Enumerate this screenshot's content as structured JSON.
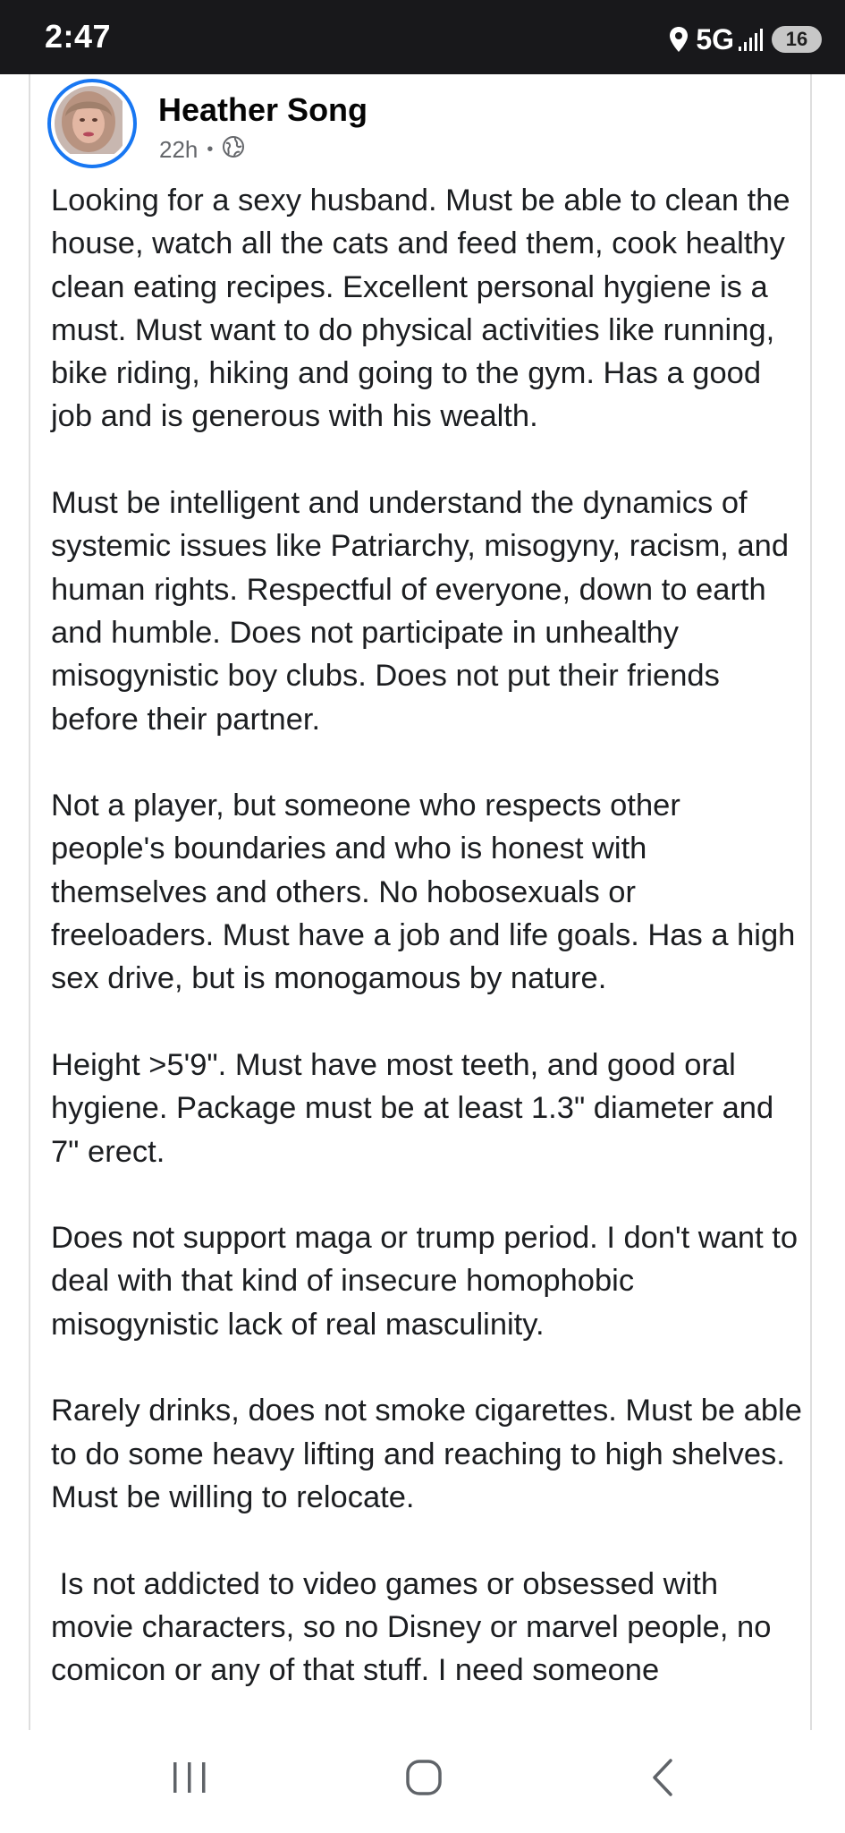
{
  "status_bar": {
    "time": "2:47",
    "network": "5G",
    "battery": "16",
    "icons": [
      "location-icon",
      "signal-icon"
    ]
  },
  "post": {
    "author": "Heather Song",
    "time_ago": "22h",
    "separator": "•",
    "audience_icon": "globe-icon",
    "accent_color": "#1877f2",
    "paragraphs": [
      "Looking for a sexy husband. Must be able to clean the house, watch all the cats and feed them, cook healthy clean eating recipes. Excellent personal hygiene is a must. Must want to do physical activities like running, bike riding, hiking and going to the gym. Has a good job and is generous with his wealth.",
      "Must be intelligent and understand the dynamics of systemic issues like Patriarchy, misogyny, racism, and human rights. Respectful of everyone, down to earth and humble. Does not participate in unhealthy misogynistic boy clubs. Does not put their friends before their partner.",
      "Not a player, but someone who respects other people's boundaries and who is honest with themselves and others. No hobosexuals or freeloaders. Must have a job and life goals. Has a high sex drive, but is monogamous by nature.",
      "Height >5'9\". Must have most teeth, and good oral hygiene. Package must be at least 1.3\" diameter and 7\" erect.",
      "Does not support maga or trump period. I don't want to deal with that kind of insecure homophobic misogynistic lack of real masculinity.",
      "Rarely drinks, does not smoke cigarettes. Must be able to do some heavy lifting and reaching to high shelves. Must be willing to relocate.",
      " Is not addicted to video games or obsessed with movie characters, so no Disney or marvel people, no comicon or any of that stuff. I need someone"
    ]
  },
  "nav_bar": {
    "buttons": [
      "recents-button",
      "home-button",
      "back-button"
    ]
  }
}
